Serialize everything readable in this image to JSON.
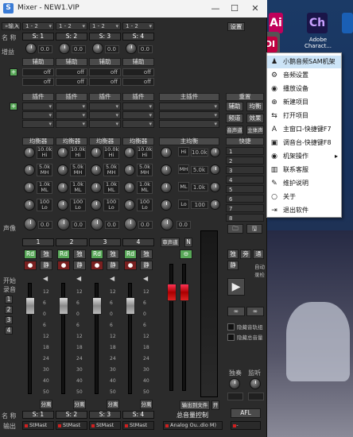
{
  "window": {
    "title": "Mixer - NEW1.VIP",
    "app_icon": "S",
    "min": "—",
    "max": "☐",
    "close": "✕"
  },
  "top_row": {
    "input": "»输入",
    "ch": [
      "1 - 2",
      "1 - 2",
      "1 - 2",
      "1 - 2"
    ],
    "settings": "设置"
  },
  "row_labels": {
    "name": "名 称",
    "gain": "增益",
    "pan": "声像",
    "start": "开始",
    "record": "录音",
    "name_bottom": "名 称",
    "output": "输出"
  },
  "channels": [
    {
      "name": "S: 1",
      "gain": "0.0",
      "num": "1",
      "eq": [
        "10.0k",
        "5.0k",
        "1.0k",
        "100"
      ],
      "bottom_name": "S: 1",
      "output": "StMast"
    },
    {
      "name": "S: 2",
      "gain": "0.0",
      "num": "2",
      "eq": [
        "10.0k",
        "5.0k",
        "1.0k",
        "100"
      ],
      "bottom_name": "S: 2",
      "output": "StMast"
    },
    {
      "name": "S: 3",
      "gain": "0.0",
      "num": "3",
      "eq": [
        "10.0k",
        "5.0k",
        "1.0k",
        "100"
      ],
      "bottom_name": "S: 3",
      "output": "StMast"
    },
    {
      "name": "S: 4",
      "gain": "0.0",
      "num": "4",
      "eq": [
        "10.0k",
        "5.0k",
        "1.0k",
        "100"
      ],
      "bottom_name": "S: 4",
      "output": "StMast"
    }
  ],
  "section_headers": {
    "aux": "辅助",
    "plugin": "插件",
    "master_plugin": "主插件",
    "reset": "重置",
    "eq": "均衡器",
    "master_eq": "主均衡",
    "quick": "快捷"
  },
  "eq_bands": [
    "Hi",
    "MH",
    "ML",
    "Lo"
  ],
  "eq_gains": [
    "0.0",
    "0.0",
    "0.0",
    "0.0"
  ],
  "off": "off",
  "side_buttons": {
    "aux": "辅助",
    "balance": "均衡",
    "dist": "频道",
    "effect": "效果",
    "sound_vol": "音声道",
    "stereo": "立体声"
  },
  "quick_slots": [
    "1",
    "2",
    "3",
    "4",
    "5",
    "6",
    "7",
    "8"
  ],
  "master": {
    "freqs": [
      "10.0k",
      "5.0k",
      "1.0k",
      "100"
    ],
    "band": [
      "Hi",
      "MH",
      "ML",
      "Lo"
    ],
    "gain": "0.0",
    "pan_label": "审声道",
    "n": "N",
    "title": "总音量控制",
    "output": "Analog Ou..dio M)",
    "file_out": "输出到文件",
    "flag": "开"
  },
  "strip_buttons": {
    "rd": "Rd",
    "solo": "独",
    "mute": "静",
    "sep": "分离"
  },
  "right_panel": {
    "solo": "独",
    "pass": "旁",
    "pass2": "通",
    "auto": "自动",
    "save": "录检",
    "hide_tracks": "隐藏音轨组",
    "hide_master": "隐藏总音量",
    "solo_label": "独奏",
    "monitor": "监听",
    "afl": "AFL"
  },
  "scale": [
    "12",
    "6",
    "0",
    "6",
    "12",
    "18",
    "24",
    "30",
    "40",
    "50"
  ],
  "desktop": {
    "midi": "MIDI",
    "adobe": "Adobe Charact...",
    "ch_label": "Ch",
    "icon2": "Ai",
    "side_text": "Stu"
  },
  "context_menu": {
    "items": [
      {
        "icon": "person-icon",
        "glyph": "♟",
        "label": "小鹅音频SAM机架",
        "hl": true
      },
      {
        "icon": "audio-settings-icon",
        "glyph": "⚙",
        "label": "音频设置"
      },
      {
        "icon": "playback-icon",
        "glyph": "◉",
        "label": "播放设备"
      },
      {
        "icon": "new-project-icon",
        "glyph": "⊕",
        "label": "新建项目"
      },
      {
        "icon": "open-project-icon",
        "glyph": "⇆",
        "label": "打开项目"
      },
      {
        "icon": "main-window-icon",
        "glyph": "A",
        "label": "主窗口-快捷键F7"
      },
      {
        "icon": "mixer-icon",
        "glyph": "▣",
        "label": "调音台-快捷键F8"
      },
      {
        "icon": "rack-icon",
        "glyph": "◉",
        "label": "机架操作",
        "sub": true
      },
      {
        "icon": "service-icon",
        "glyph": "▥",
        "label": "联系客服"
      },
      {
        "icon": "help-icon",
        "glyph": "✎",
        "label": "维护说明"
      },
      {
        "icon": "about-icon",
        "glyph": "○",
        "label": "关于"
      },
      {
        "icon": "exit-icon",
        "glyph": "⇥",
        "label": "退出软件"
      }
    ]
  }
}
